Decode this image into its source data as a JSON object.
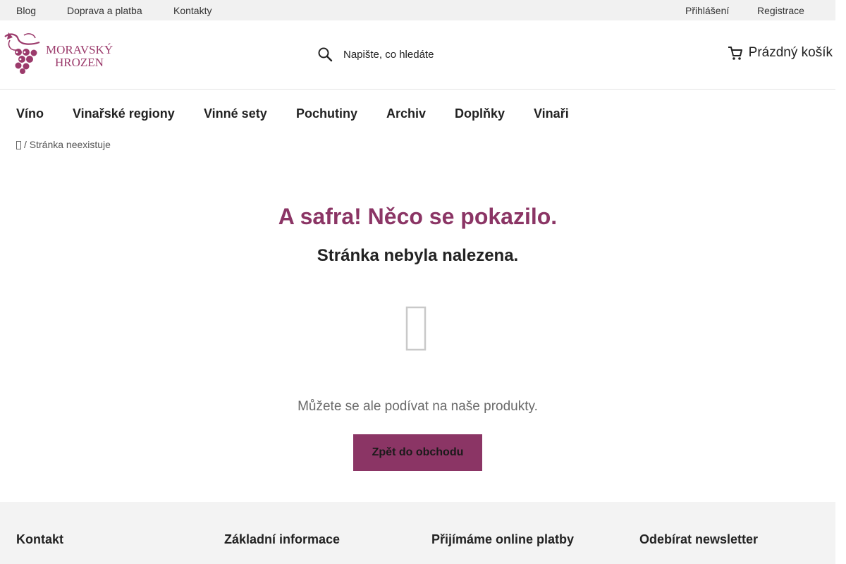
{
  "topbar": {
    "links": [
      "Blog",
      "Doprava a platba",
      "Kontakty"
    ],
    "login": "Přihlášení",
    "register": "Registrace"
  },
  "logo": {
    "line1": "MORAVSKÝ",
    "line2": "HROZEN",
    "icon": "grape-vine-icon",
    "color": "#9b3a6b"
  },
  "search": {
    "placeholder": "Napište, co hledáte",
    "value": "",
    "icon": "search-icon"
  },
  "cart": {
    "label": "Prázdný košík",
    "icon": "cart-icon"
  },
  "nav": {
    "items": [
      "Víno",
      "Vinařské regiony",
      "Vinné sety",
      "Pochutiny",
      "Archiv",
      "Doplňky",
      "Vinaři"
    ]
  },
  "breadcrumb": {
    "home_icon": "home-icon",
    "current": "/ Stránka neexistuje"
  },
  "error": {
    "title": "A safra! Něco se pokazilo.",
    "subtitle": "Stránka nebyla nalezena.",
    "icon": "missing-glyph-icon",
    "hint": "Můžete se ale podívat na naše produkty.",
    "button": "Zpět do obchodu"
  },
  "footer": {
    "columns": [
      "Kontakt",
      "Základní informace",
      "Přijímáme online platby",
      "Odebírat newsletter"
    ]
  },
  "colors": {
    "accent": "#8b3565",
    "topbar_bg": "#f1f1f1",
    "footer_bg": "#f3f3f3"
  }
}
